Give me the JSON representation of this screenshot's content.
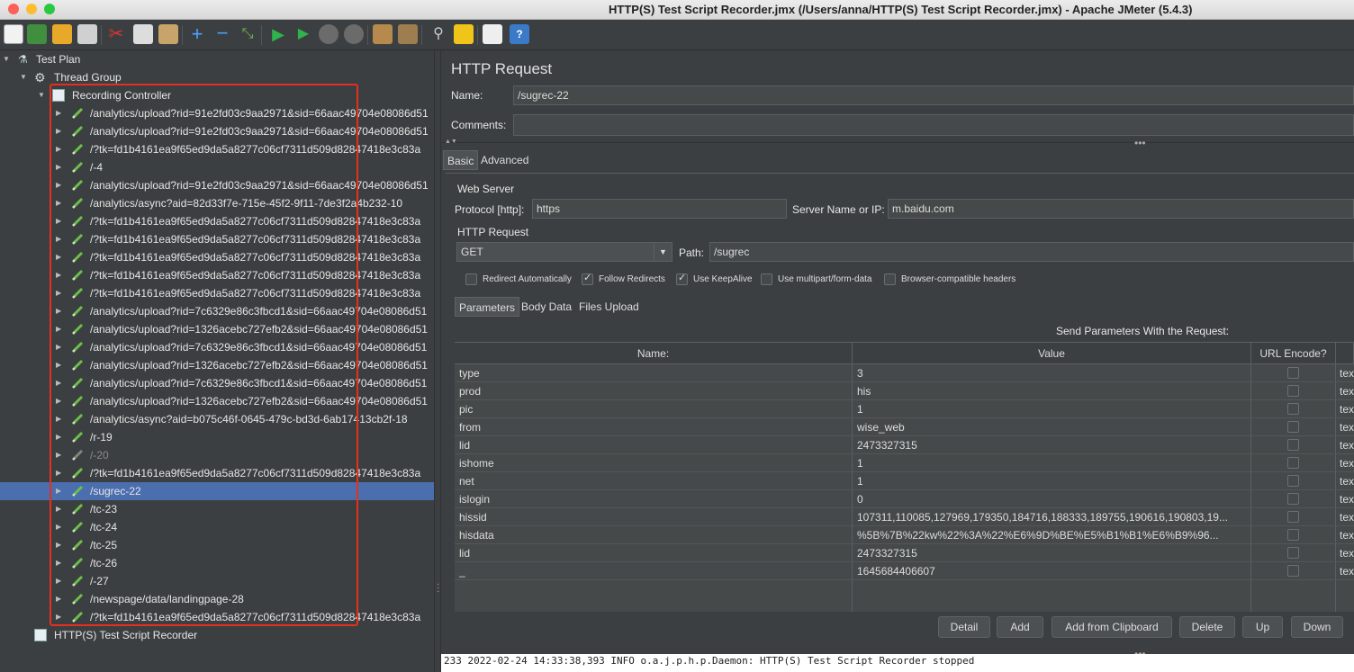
{
  "window": {
    "title": "HTTP(S) Test Script Recorder.jmx (/Users/anna/HTTP(S) Test Script Recorder.jmx) - Apache JMeter (5.4.3)"
  },
  "tree": {
    "test_plan": "Test Plan",
    "thread_group": "Thread Group",
    "recording_controller": "Recording Controller",
    "items": [
      "/analytics/upload?rid=91e2fd03c9aa2971&sid=66aac49704e08086d51",
      "/analytics/upload?rid=91e2fd03c9aa2971&sid=66aac49704e08086d51",
      "/?tk=fd1b4161ea9f65ed9da5a8277c06cf7311d509d82847418e3c83a",
      "/-4",
      "/analytics/upload?rid=91e2fd03c9aa2971&sid=66aac49704e08086d51",
      "/analytics/async?aid=82d33f7e-715e-45f2-9f11-7de3f2a4b232-10",
      "/?tk=fd1b4161ea9f65ed9da5a8277c06cf7311d509d82847418e3c83a",
      "/?tk=fd1b4161ea9f65ed9da5a8277c06cf7311d509d82847418e3c83a",
      "/?tk=fd1b4161ea9f65ed9da5a8277c06cf7311d509d82847418e3c83a",
      "/?tk=fd1b4161ea9f65ed9da5a8277c06cf7311d509d82847418e3c83a",
      "/?tk=fd1b4161ea9f65ed9da5a8277c06cf7311d509d82847418e3c83a",
      "/analytics/upload?rid=7c6329e86c3fbcd1&sid=66aac49704e08086d51",
      "/analytics/upload?rid=1326acebc727efb2&sid=66aac49704e08086d51",
      "/analytics/upload?rid=7c6329e86c3fbcd1&sid=66aac49704e08086d51",
      "/analytics/upload?rid=1326acebc727efb2&sid=66aac49704e08086d51",
      "/analytics/upload?rid=7c6329e86c3fbcd1&sid=66aac49704e08086d51",
      "/analytics/upload?rid=1326acebc727efb2&sid=66aac49704e08086d51",
      "/analytics/async?aid=b075c46f-0645-479c-bd3d-6ab17413cb2f-18",
      "/r-19",
      "/-20",
      "/?tk=fd1b4161ea9f65ed9da5a8277c06cf7311d509d82847418e3c83a",
      "/sugrec-22",
      "/tc-23",
      "/tc-24",
      "/tc-25",
      "/tc-26",
      "/-27",
      "/newspage/data/landingpage-28",
      "/?tk=fd1b4161ea9f65ed9da5a8277c06cf7311d509d82847418e3c83a"
    ],
    "recorder": "HTTP(S) Test Script Recorder"
  },
  "panel": {
    "heading": "HTTP Request",
    "name_label": "Name:",
    "name_value": "/sugrec-22",
    "comments_label": "Comments:",
    "comments_value": "",
    "tabs": [
      "Basic",
      "Advanced"
    ],
    "web_server_label": "Web Server",
    "protocol_label": "Protocol [http]:",
    "protocol_value": "https",
    "server_label": "Server Name or IP:",
    "server_value": "m.baidu.com",
    "http_request_label": "HTTP Request",
    "method_value": "GET",
    "path_label": "Path:",
    "path_value": "/sugrec",
    "options": [
      {
        "label": "Redirect Automatically",
        "checked": false
      },
      {
        "label": "Follow Redirects",
        "checked": true
      },
      {
        "label": "Use KeepAlive",
        "checked": true
      },
      {
        "label": "Use multipart/form-data",
        "checked": false
      },
      {
        "label": "Browser-compatible headers",
        "checked": false
      }
    ],
    "subtabs": [
      "Parameters",
      "Body Data",
      "Files Upload"
    ],
    "send_params_label": "Send Parameters With the Request:",
    "columns": [
      "Name:",
      "Value",
      "URL Encode?"
    ],
    "params": [
      {
        "name": "type",
        "value": "3"
      },
      {
        "name": "prod",
        "value": "his"
      },
      {
        "name": "pic",
        "value": "1"
      },
      {
        "name": "from",
        "value": "wise_web"
      },
      {
        "name": "lid",
        "value": "2473327315"
      },
      {
        "name": "ishome",
        "value": "1"
      },
      {
        "name": "net",
        "value": "1"
      },
      {
        "name": "islogin",
        "value": "0"
      },
      {
        "name": "hissid",
        "value": "107311,110085,127969,179350,184716,188333,189755,190616,190803,19..."
      },
      {
        "name": "hisdata",
        "value": "%5B%7B%22kw%22%3A%22%E6%9D%BE%E5%B1%B1%E6%B9%96..."
      },
      {
        "name": "lid",
        "value": "2473327315"
      },
      {
        "name": "_",
        "value": "1645684406607"
      }
    ],
    "row_suffix": "tex",
    "buttons": [
      "Detail",
      "Add",
      "Add from Clipboard",
      "Delete",
      "Up",
      "Down"
    ]
  },
  "log": {
    "line1": "233 2022-02-24 14:33:38,393 INFO o.a.j.p.h.p.Daemon: HTTP(S) Test Script Recorder stopped"
  }
}
